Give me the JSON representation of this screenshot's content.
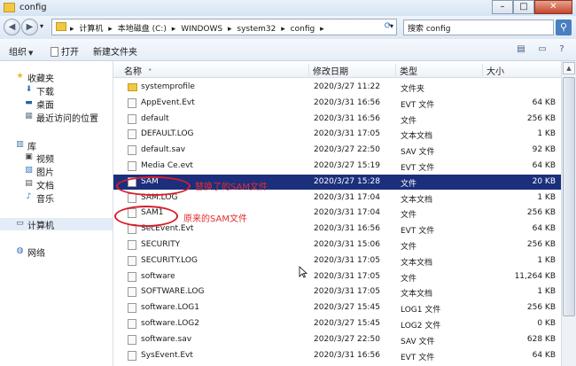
{
  "window": {
    "title": "config",
    "min_label": "–",
    "max_label": "□",
    "close_label": "✕"
  },
  "nav": {
    "back_label": "◀",
    "forward_label": "▶",
    "history_label": "▾"
  },
  "address": {
    "crumbs": [
      "▸",
      "计算机",
      "▸",
      "本地磁盘 (C:)",
      "▸",
      "WINDOWS",
      "▸",
      "system32",
      "▸",
      "config",
      "▸"
    ],
    "dropdown_label": "▾",
    "refresh_label": "⟳"
  },
  "search": {
    "placeholder": "搜索 config",
    "button_label": "⚲"
  },
  "toolbar": {
    "organize_label": "组织",
    "open_label": "打开",
    "new_folder_label": "新建文件夹"
  },
  "sidebar": {
    "favorites_label": "收藏夹",
    "favorites": [
      "下载",
      "桌面",
      "最近访问的位置"
    ],
    "libraries_label": "库",
    "libraries": [
      "视频",
      "图片",
      "文档",
      "音乐"
    ],
    "computer_label": "计算机",
    "network_label": "网络"
  },
  "columns": {
    "name": "名称",
    "date": "修改日期",
    "type": "类型",
    "size": "大小",
    "sort_arrow": "˄"
  },
  "files": [
    {
      "name": "systemprofile",
      "date": "2020/3/27 11:22",
      "type": "文件夹",
      "size": "",
      "folder": true
    },
    {
      "name": "AppEvent.Evt",
      "date": "2020/3/31 16:56",
      "type": "EVT 文件",
      "size": "64 KB"
    },
    {
      "name": "default",
      "date": "2020/3/31 16:56",
      "type": "文件",
      "size": "256 KB"
    },
    {
      "name": "DEFAULT.LOG",
      "date": "2020/3/31 17:05",
      "type": "文本文档",
      "size": "1 KB"
    },
    {
      "name": "default.sav",
      "date": "2020/3/27 22:50",
      "type": "SAV 文件",
      "size": "92 KB"
    },
    {
      "name": "Media Ce.evt",
      "date": "2020/3/27 15:19",
      "type": "EVT 文件",
      "size": "64 KB"
    },
    {
      "name": "SAM",
      "date": "2020/3/27 15:28",
      "type": "文件",
      "size": "20 KB",
      "selected": true
    },
    {
      "name": "SAM.LOG",
      "date": "2020/3/31 17:04",
      "type": "文本文档",
      "size": "1 KB"
    },
    {
      "name": "SAM1",
      "date": "2020/3/31 17:04",
      "type": "文件",
      "size": "256 KB"
    },
    {
      "name": "SecEvent.Evt",
      "date": "2020/3/31 16:56",
      "type": "EVT 文件",
      "size": "64 KB"
    },
    {
      "name": "SECURITY",
      "date": "2020/3/31 15:06",
      "type": "文件",
      "size": "256 KB"
    },
    {
      "name": "SECURITY.LOG",
      "date": "2020/3/31 17:05",
      "type": "文本文档",
      "size": "1 KB"
    },
    {
      "name": "software",
      "date": "2020/3/31 17:05",
      "type": "文件",
      "size": "11,264 KB"
    },
    {
      "name": "SOFTWARE.LOG",
      "date": "2020/3/31 17:05",
      "type": "文本文档",
      "size": "1 KB"
    },
    {
      "name": "software.LOG1",
      "date": "2020/3/27 15:45",
      "type": "LOG1 文件",
      "size": "256 KB"
    },
    {
      "name": "software.LOG2",
      "date": "2020/3/27 15:45",
      "type": "LOG2 文件",
      "size": "0 KB"
    },
    {
      "name": "software.sav",
      "date": "2020/3/27 22:50",
      "type": "SAV 文件",
      "size": "628 KB"
    },
    {
      "name": "SysEvent.Evt",
      "date": "2020/3/31 16:56",
      "type": "EVT 文件",
      "size": "64 KB"
    }
  ],
  "annotations": {
    "replaced_sam": "替换了的SAM文件",
    "original_sam": "原来的SAM文件"
  },
  "colors": {
    "selected_row": "#1c2f7c",
    "annotation_red": "#e52d2d"
  }
}
